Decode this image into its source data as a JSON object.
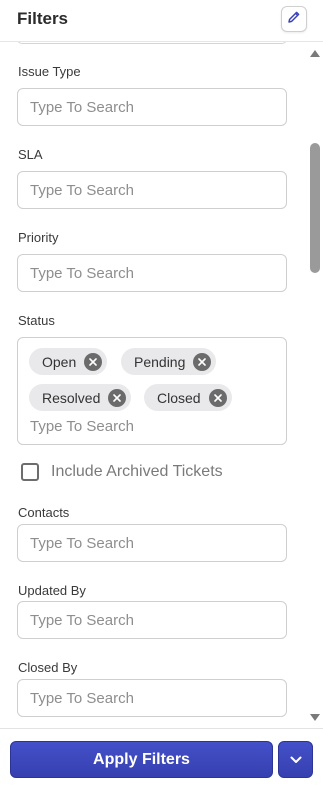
{
  "header": {
    "title": "Filters",
    "edit_icon": "pencil-icon"
  },
  "fields": {
    "issue_type": {
      "label": "Issue Type",
      "placeholder": "Type To Search"
    },
    "sla": {
      "label": "SLA",
      "placeholder": "Type To Search"
    },
    "priority": {
      "label": "Priority",
      "placeholder": "Type To Search"
    },
    "status": {
      "label": "Status",
      "chips": [
        "Open",
        "Pending",
        "Resolved",
        "Closed"
      ],
      "placeholder": "Type To Search"
    },
    "include_archived": {
      "label": "Include Archived Tickets",
      "checked": false
    },
    "contacts": {
      "label": "Contacts",
      "placeholder": "Type To Search"
    },
    "updated_by": {
      "label": "Updated By",
      "placeholder": "Type To Search"
    },
    "closed_by": {
      "label": "Closed By",
      "placeholder": "Type To Search"
    }
  },
  "footer": {
    "apply_label": "Apply Filters",
    "dropdown_icon": "chevron-down-icon"
  },
  "colors": {
    "primary": "#3a44b8",
    "border": "#cfcfcf",
    "chip_bg": "#e9e9ec"
  }
}
